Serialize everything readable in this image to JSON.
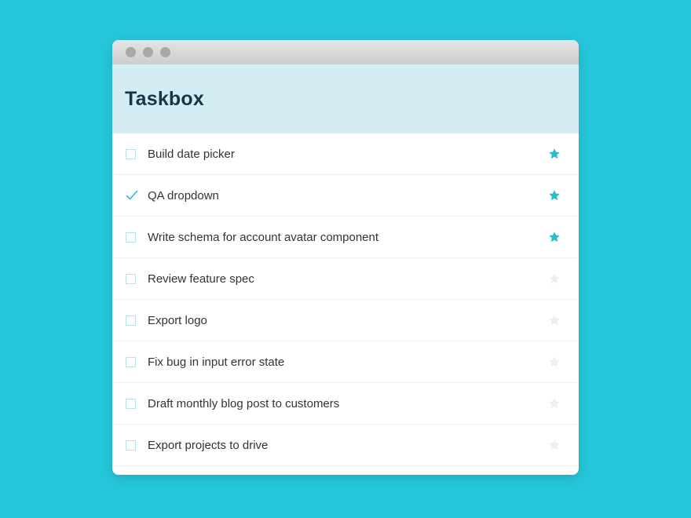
{
  "app": {
    "title": "Taskbox"
  },
  "colors": {
    "background": "#26c6da",
    "header": "#d4edf4",
    "star_active": "#2bbcd2",
    "star_inactive": "#eeeeee",
    "checkmark": "#2bbcd2"
  },
  "icons": {
    "checkbox": "checkbox-icon",
    "checkmark": "checkmark-icon",
    "star": "star-icon"
  },
  "tasks": [
    {
      "title": "Build date picker",
      "checked": false,
      "pinned": true
    },
    {
      "title": "QA dropdown",
      "checked": true,
      "pinned": true
    },
    {
      "title": "Write schema for account avatar component",
      "checked": false,
      "pinned": true
    },
    {
      "title": "Review feature spec",
      "checked": false,
      "pinned": false
    },
    {
      "title": "Export logo",
      "checked": false,
      "pinned": false
    },
    {
      "title": "Fix bug in input error state",
      "checked": false,
      "pinned": false
    },
    {
      "title": "Draft monthly blog post to customers",
      "checked": false,
      "pinned": false
    },
    {
      "title": "Export projects to drive",
      "checked": false,
      "pinned": false
    }
  ]
}
